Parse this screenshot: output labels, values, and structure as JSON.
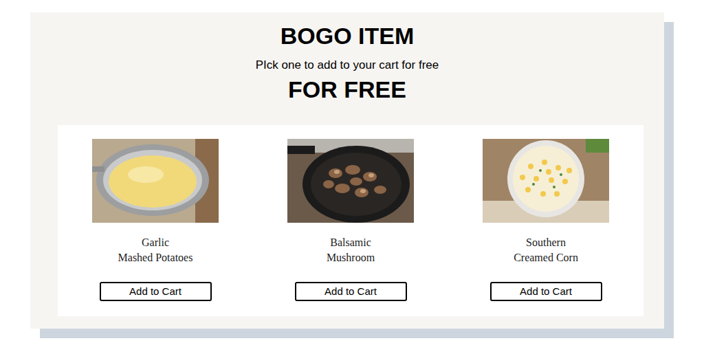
{
  "card": {
    "title": "BOGO ITEM",
    "subtitle": "PIck one to add to your cart for free",
    "emphasis": "FOR FREE"
  },
  "items": [
    {
      "name_lines": [
        "Garlic",
        "Mashed Potatoes"
      ],
      "button": "Add to Cart",
      "kind": "potatoes"
    },
    {
      "name_lines": [
        "Balsamic",
        "Mushroom"
      ],
      "button": "Add to Cart",
      "kind": "mushroom"
    },
    {
      "name_lines": [
        "Southern",
        "Creamed Corn"
      ],
      "button": "Add to Cart",
      "kind": "corn"
    }
  ]
}
